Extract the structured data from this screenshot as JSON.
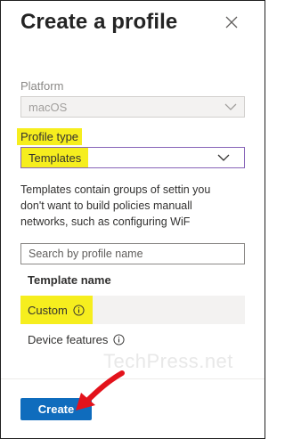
{
  "panel": {
    "title": "Create a profile",
    "close_icon": "close-icon"
  },
  "platform": {
    "label": "Platform",
    "value": "macOS"
  },
  "profile_type": {
    "label": "Profile type",
    "value": "Templates"
  },
  "description": {
    "line1": "Templates contain groups of settin you",
    "line2": "don't want to build policies manuall",
    "line3": "networks, such as configuring WiF"
  },
  "search": {
    "placeholder": "Search by profile name"
  },
  "table": {
    "header": "Template name",
    "rows": [
      {
        "name": "Custom",
        "icon": "info-icon"
      },
      {
        "name": "Device features",
        "icon": "info-icon"
      }
    ]
  },
  "watermark": "TechPress.net",
  "footer": {
    "create_label": "Create"
  },
  "colors": {
    "highlight": "#f6ee1e",
    "primary_button": "#0f6cbd",
    "annotation_arrow": "#e3121b"
  }
}
